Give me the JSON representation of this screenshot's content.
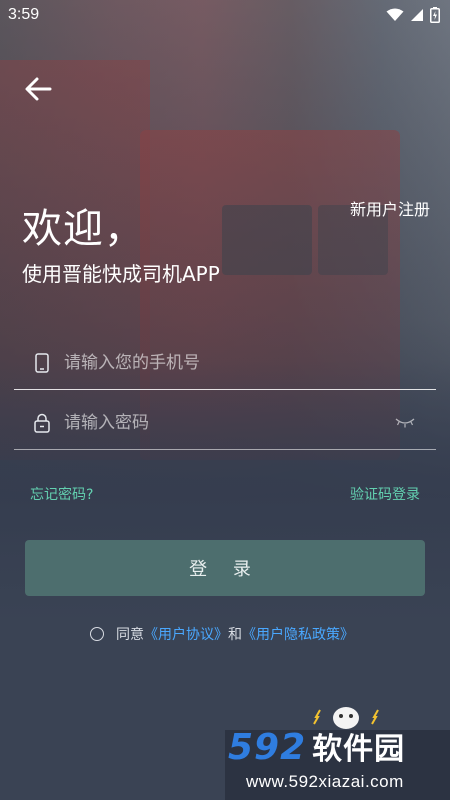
{
  "statusbar": {
    "time": "3:59"
  },
  "header": {
    "register_label": "新用户注册"
  },
  "welcome": {
    "title": "欢迎，",
    "subtitle": "使用晋能快成司机APP"
  },
  "form": {
    "phone_placeholder": "请输入您的手机号",
    "password_placeholder": "请输入密码"
  },
  "links": {
    "forgot_password": "忘记密码?",
    "sms_login": "验证码登录"
  },
  "login_button": "登 录",
  "agreement": {
    "prefix": "同意",
    "user_agreement": "《用户协议》",
    "and": "和",
    "privacy_policy": "《用户隐私政策》"
  },
  "watermark": {
    "logo_num": "592",
    "logo_cn": "软件园",
    "url": "www.592xiazai.com"
  },
  "colors": {
    "accent_link": "#63d0b0",
    "login_button": "#4d6e6e",
    "agreement_link": "#4aa8ff"
  }
}
